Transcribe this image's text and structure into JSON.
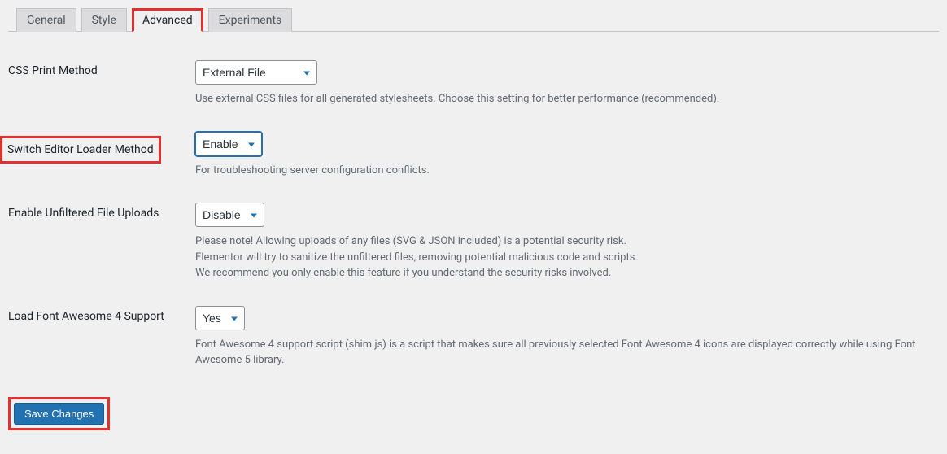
{
  "tabs": {
    "general": "General",
    "style": "Style",
    "advanced": "Advanced",
    "experiments": "Experiments"
  },
  "settings": {
    "css_print": {
      "label": "CSS Print Method",
      "value": "External File",
      "description": "Use external CSS files for all generated stylesheets. Choose this setting for better performance (recommended)."
    },
    "switch_loader": {
      "label": "Switch Editor Loader Method",
      "value": "Enable",
      "description": "For troubleshooting server configuration conflicts."
    },
    "unfiltered_uploads": {
      "label": "Enable Unfiltered File Uploads",
      "value": "Disable",
      "description_line1": "Please note! Allowing uploads of any files (SVG & JSON included) is a potential security risk.",
      "description_line2": "Elementor will try to sanitize the unfiltered files, removing potential malicious code and scripts.",
      "description_line3": "We recommend you only enable this feature if you understand the security risks involved."
    },
    "fa4": {
      "label": "Load Font Awesome 4 Support",
      "value": "Yes",
      "description": "Font Awesome 4 support script (shim.js) is a script that makes sure all previously selected Font Awesome 4 icons are displayed correctly while using Font Awesome 5 library."
    }
  },
  "submit": {
    "label": "Save Changes"
  }
}
